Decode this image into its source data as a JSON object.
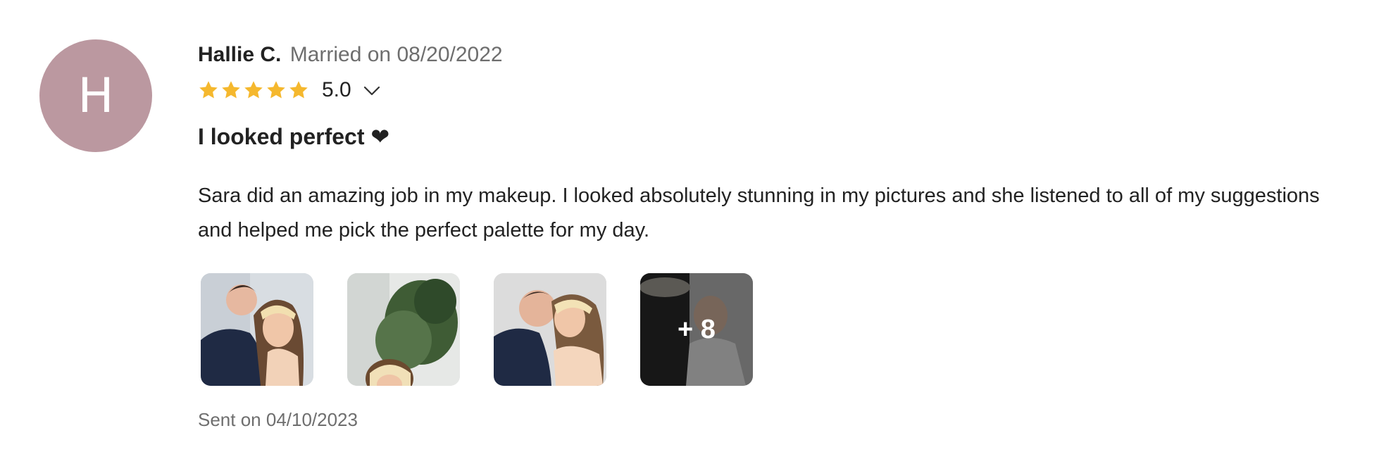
{
  "review": {
    "avatar_initial": "H",
    "reviewer_name": "Hallie C.",
    "married_text": "Married on 08/20/2022",
    "rating": 5,
    "rating_text": "5.0",
    "title": "I looked perfect",
    "title_emoji": "❤",
    "body": "Sara did an amazing job in my makeup. I looked absolutely stunning in my pictures and she listened to all of my suggestions and helped me pick the perfect palette for my day.",
    "more_photos_label": "+ 8",
    "sent_text": "Sent on 04/10/2023"
  },
  "colors": {
    "avatar_bg": "#bb98a0",
    "star": "#f5b82e",
    "muted_text": "#6e6e6e"
  },
  "icons": {
    "star": "star-icon",
    "chevron": "chevron-down-icon"
  }
}
